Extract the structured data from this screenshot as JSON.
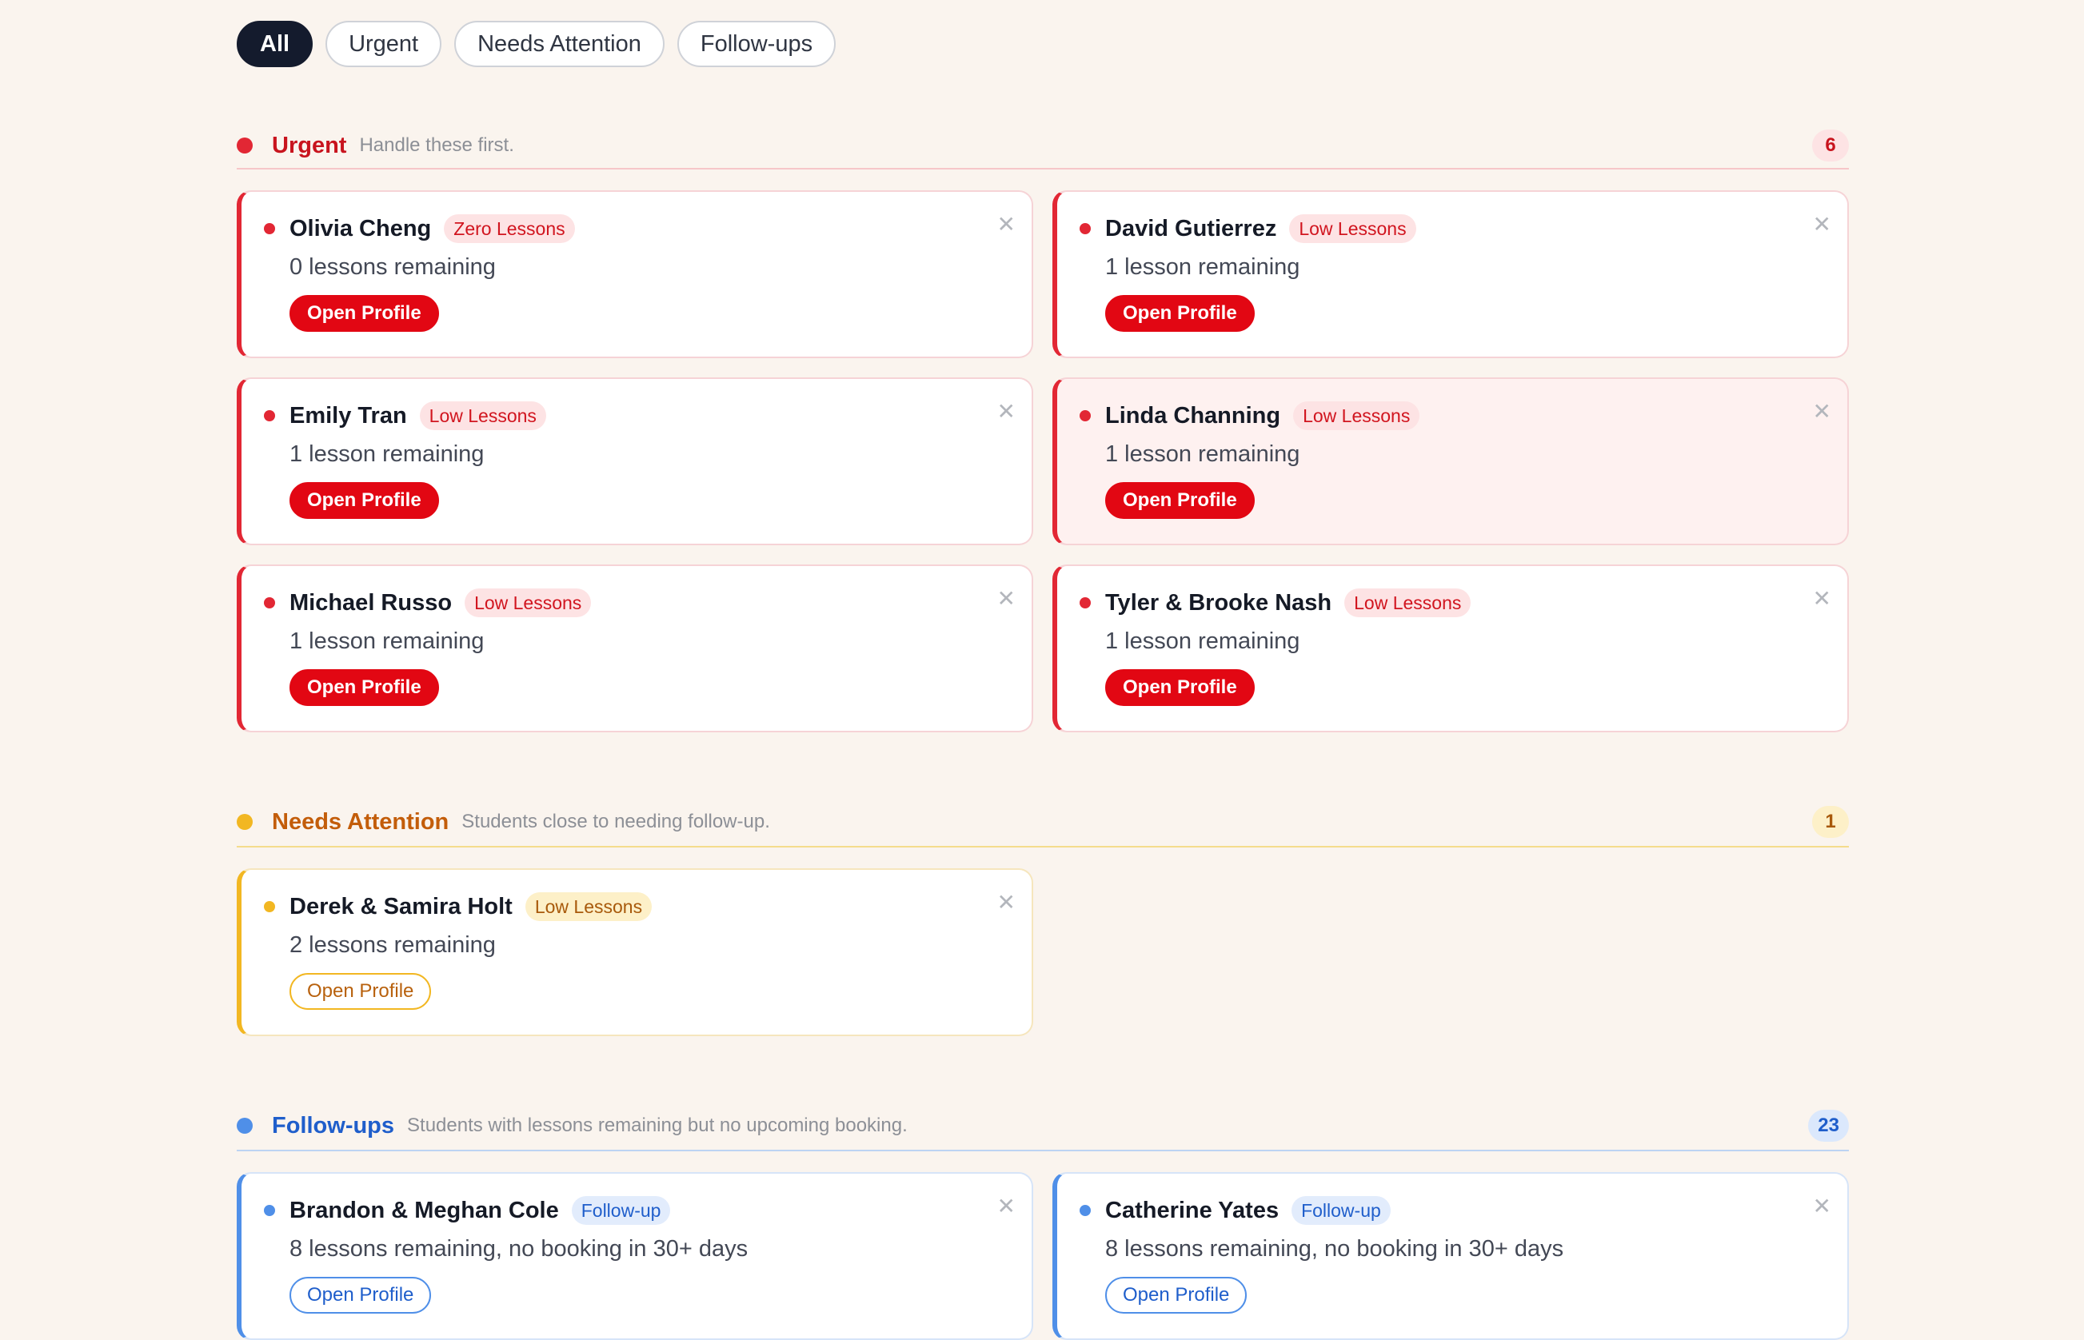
{
  "filters": [
    {
      "label": "All",
      "active": true
    },
    {
      "label": "Urgent",
      "active": false
    },
    {
      "label": "Needs Attention",
      "active": false
    },
    {
      "label": "Follow-ups",
      "active": false
    }
  ],
  "colors": {
    "urgent": "#e22734",
    "attention": "#f2b722",
    "followup": "#4f8fe8",
    "page_bg": "#faf4ee"
  },
  "icons": {
    "close": "close-icon",
    "status_dot": "status-dot"
  },
  "sections": {
    "urgent": {
      "title": "Urgent",
      "subtitle": "Handle these first.",
      "count": "6",
      "cards": [
        {
          "name": "Olivia Cheng",
          "badge": "Zero Lessons",
          "detail": "0 lessons remaining",
          "action": "Open Profile"
        },
        {
          "name": "David Gutierrez",
          "badge": "Low Lessons",
          "detail": "1 lesson remaining",
          "action": "Open Profile"
        },
        {
          "name": "Emily Tran",
          "badge": "Low Lessons",
          "detail": "1 lesson remaining",
          "action": "Open Profile"
        },
        {
          "name": "Linda Channing",
          "badge": "Low Lessons",
          "detail": "1 lesson remaining",
          "action": "Open Profile"
        },
        {
          "name": "Michael Russo",
          "badge": "Low Lessons",
          "detail": "1 lesson remaining",
          "action": "Open Profile"
        },
        {
          "name": "Tyler & Brooke Nash",
          "badge": "Low Lessons",
          "detail": "1 lesson remaining",
          "action": "Open Profile"
        }
      ]
    },
    "attention": {
      "title": "Needs Attention",
      "subtitle": "Students close to needing follow-up.",
      "count": "1",
      "cards": [
        {
          "name": "Derek & Samira Holt",
          "badge": "Low Lessons",
          "detail": "2 lessons remaining",
          "action": "Open Profile"
        }
      ]
    },
    "followups": {
      "title": "Follow-ups",
      "subtitle": "Students with lessons remaining but no upcoming booking.",
      "count": "23",
      "cards": [
        {
          "name": "Brandon & Meghan Cole",
          "badge": "Follow-up",
          "detail": "8 lessons remaining, no booking in 30+ days",
          "action": "Open Profile"
        },
        {
          "name": "Catherine Yates",
          "badge": "Follow-up",
          "detail": "8 lessons remaining, no booking in 30+ days",
          "action": "Open Profile"
        }
      ]
    }
  }
}
